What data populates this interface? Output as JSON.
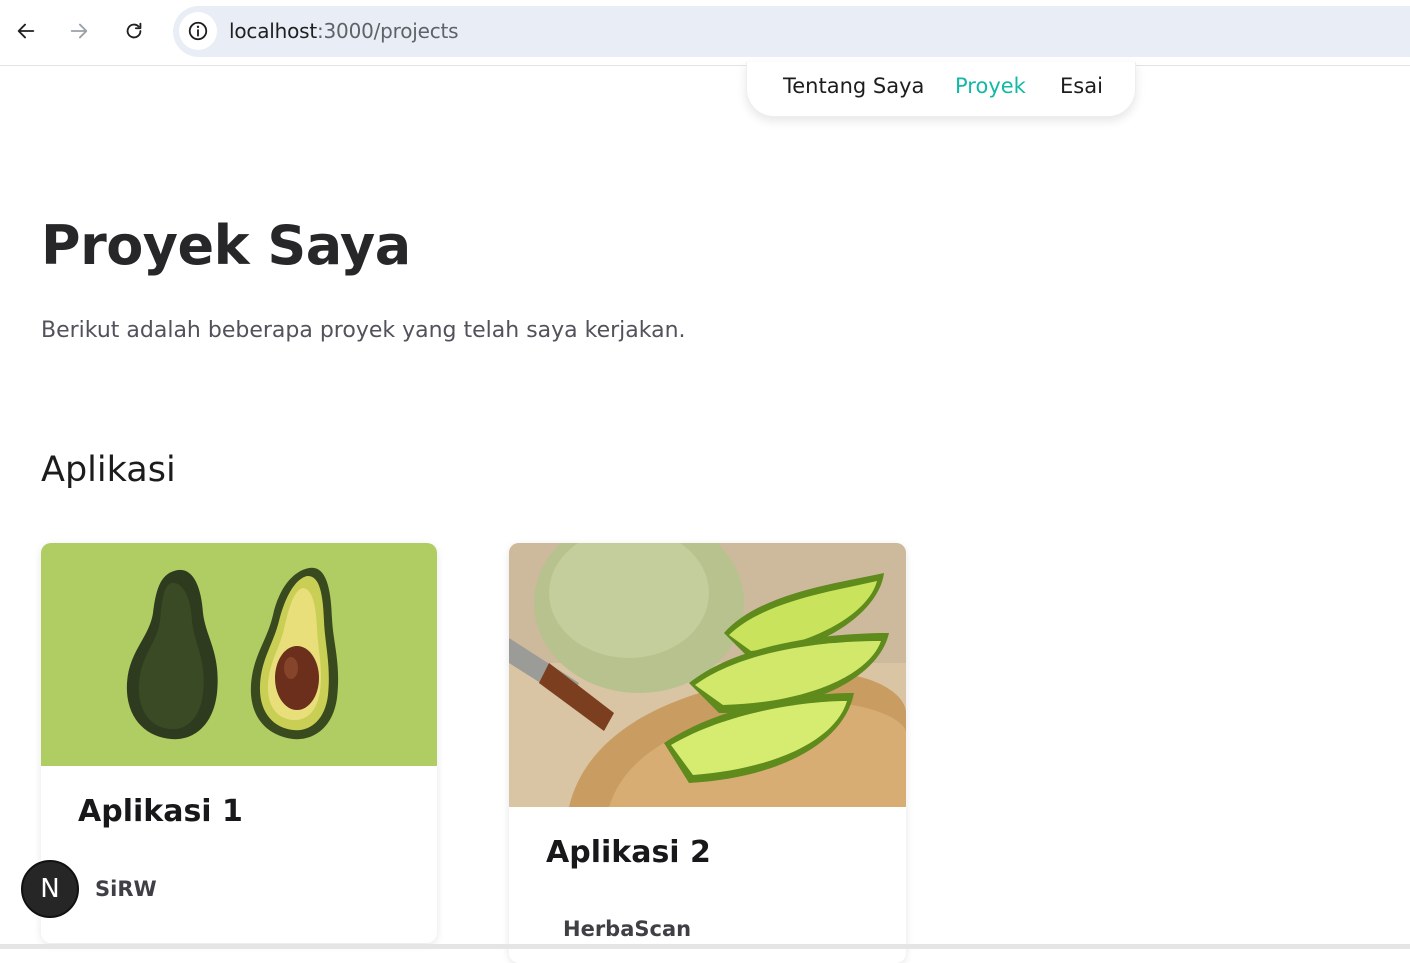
{
  "browser": {
    "url_host": "localhost",
    "url_rest": ":3000/projects"
  },
  "topnav": {
    "items": [
      {
        "label": "Tentang Saya",
        "active": false
      },
      {
        "label": "Proyek",
        "active": true
      },
      {
        "label": "Esai",
        "active": false
      }
    ],
    "active_color": "#14b8a6"
  },
  "page": {
    "title": "Proyek Saya",
    "description": "Berikut adalah beberapa proyek yang telah saya kerjakan."
  },
  "section": {
    "title": "Aplikasi",
    "cards": [
      {
        "title": "Aplikasi 1",
        "subtitle": "SiRW",
        "image": "avocado-photo"
      },
      {
        "title": "Aplikasi 2",
        "subtitle": "HerbaScan",
        "image": "melon-photo"
      }
    ]
  },
  "dev_badge": {
    "letter": "N"
  }
}
